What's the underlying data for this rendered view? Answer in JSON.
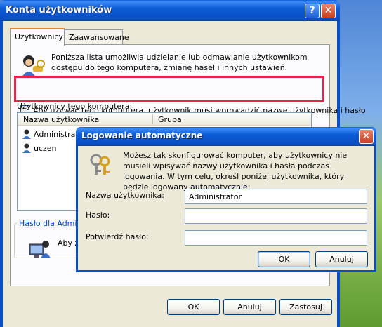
{
  "main_window": {
    "title": "Konta użytkowników",
    "tabs": [
      "Użytkownicy",
      "Zaawansowane"
    ],
    "description": "Poniższa lista umożliwia udzielanie lub odmawianie użytkownikom dostępu do tego komputera, zmianę haseł i innych ustawień.",
    "require_login_checkbox_label": "Aby używać tego komputera, użytkownik musi wprowadzić nazwę użytkownika i hasło",
    "require_login_checked": false,
    "users_section_label": "Użytkownicy tego komputera:",
    "list_columns": [
      "Nazwa użytkownika",
      "Grupa"
    ],
    "list_rows": [
      {
        "name": "Administrat"
      },
      {
        "name": "uczen"
      }
    ],
    "password_group_title": "Hasło dla Admi",
    "password_group_text": "Aby z",
    "buttons": {
      "ok": "OK",
      "cancel": "Anuluj",
      "apply": "Zastosuj"
    }
  },
  "autologon_dialog": {
    "title": "Logowanie automatyczne",
    "description": "Możesz tak skonfigurować komputer, aby użytkownicy nie musieli wpisywać nazwy użytkownika i hasła podczas logowania. W tym celu, określ poniżej użytkownika, który będzie logowany automatycznie:",
    "fields": {
      "username_label": "Nazwa użytkownika:",
      "username_value": "Administrator",
      "password_label": "Hasło:",
      "password_value": "",
      "confirm_label": "Potwierdź hasło:",
      "confirm_value": ""
    },
    "buttons": {
      "ok": "OK",
      "cancel": "Anuluj"
    }
  },
  "colors": {
    "titlebar": "#0a4fc4",
    "highlight": "#e0284a",
    "dialog_bg": "#ece9d8"
  },
  "icons": [
    "help-icon",
    "close-icon",
    "users-icon",
    "user-icon",
    "computer-user-icon",
    "keys-icon"
  ]
}
